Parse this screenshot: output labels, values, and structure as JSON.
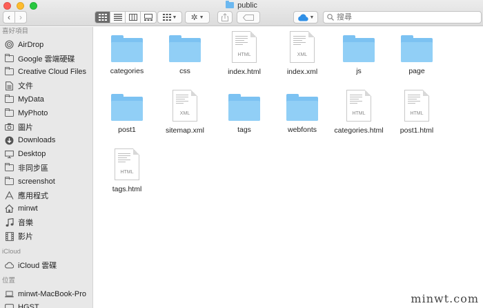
{
  "window": {
    "title": "public"
  },
  "toolbar": {
    "back_glyph": "‹",
    "forward_glyph": "›",
    "search_placeholder": "搜尋"
  },
  "sidebar": {
    "sections": [
      {
        "title": "喜好項目",
        "items": [
          {
            "label": "AirDrop",
            "icon": "airdrop-icon"
          },
          {
            "label": "Google 雲端硬碟",
            "icon": "folder-icon"
          },
          {
            "label": "Creative Cloud Files",
            "icon": "folder-icon"
          },
          {
            "label": "文件",
            "icon": "document-icon"
          },
          {
            "label": "MyData",
            "icon": "folder-icon"
          },
          {
            "label": "MyPhoto",
            "icon": "folder-icon"
          },
          {
            "label": "圖片",
            "icon": "camera-icon"
          },
          {
            "label": "Downloads",
            "icon": "download-icon"
          },
          {
            "label": "Desktop",
            "icon": "desktop-icon"
          },
          {
            "label": "非同步區",
            "icon": "folder-icon"
          },
          {
            "label": "screenshot",
            "icon": "folder-icon"
          },
          {
            "label": "應用程式",
            "icon": "applications-icon"
          },
          {
            "label": "minwt",
            "icon": "home-icon"
          },
          {
            "label": "音樂",
            "icon": "music-icon"
          },
          {
            "label": "影片",
            "icon": "movie-icon"
          }
        ]
      },
      {
        "title": "iCloud",
        "items": [
          {
            "label": "iCloud 雲碟",
            "icon": "cloud-icon"
          }
        ]
      },
      {
        "title": "位置",
        "items": [
          {
            "label": "minwt-MacBook-Pro",
            "icon": "laptop-icon"
          },
          {
            "label": "HGST",
            "icon": "drive-icon"
          }
        ]
      }
    ]
  },
  "files": [
    {
      "name": "categories",
      "kind": "folder"
    },
    {
      "name": "css",
      "kind": "folder"
    },
    {
      "name": "index.html",
      "kind": "doc",
      "ext": "HTML"
    },
    {
      "name": "index.xml",
      "kind": "doc",
      "ext": "XML"
    },
    {
      "name": "js",
      "kind": "folder"
    },
    {
      "name": "page",
      "kind": "folder"
    },
    {
      "name": "post1",
      "kind": "folder"
    },
    {
      "name": "sitemap.xml",
      "kind": "doc",
      "ext": "XML"
    },
    {
      "name": "tags",
      "kind": "folder"
    },
    {
      "name": "webfonts",
      "kind": "folder"
    },
    {
      "name": "categories.html",
      "kind": "doc",
      "ext": "HTML"
    },
    {
      "name": "post1.html",
      "kind": "doc",
      "ext": "HTML"
    },
    {
      "name": "tags.html",
      "kind": "doc",
      "ext": "HTML"
    }
  ],
  "watermark": "minwt.com",
  "colors": {
    "folder": "#91cff6",
    "close": "#fd5f57",
    "minimize": "#febc2e",
    "maximize": "#28c840"
  }
}
